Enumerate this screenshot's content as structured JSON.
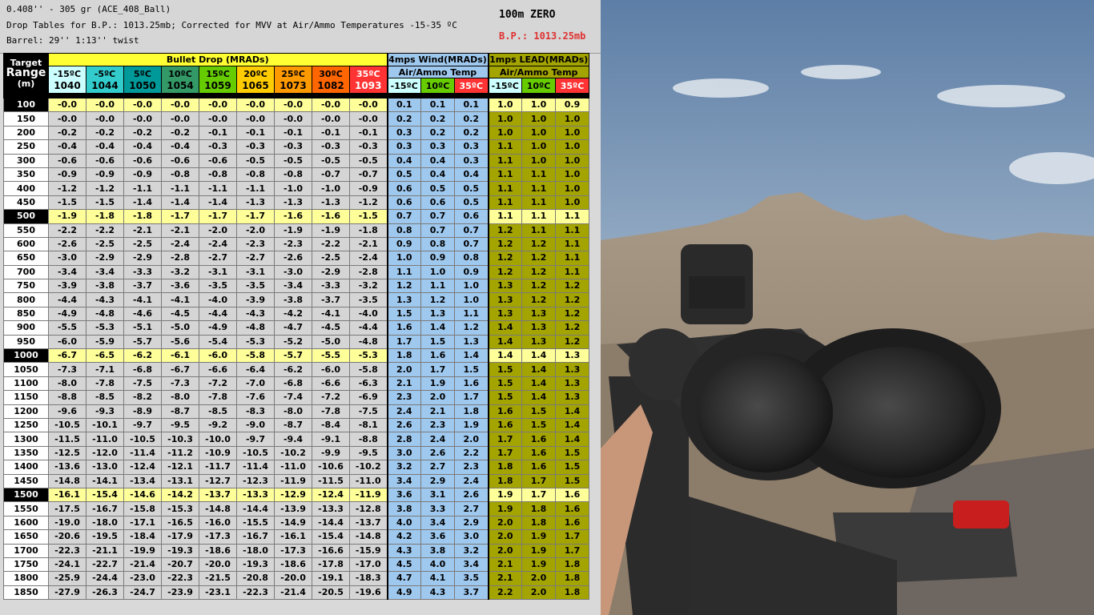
{
  "header": {
    "line1": "0.408'' - 305 gr (ACE_408_Ball)",
    "line2": "Drop Tables for B.P.: 1013.25mb; Corrected for MVV at Air/Ammo Temperatures -15-35 ºC",
    "line3": "Barrel: 29'' 1:13'' twist",
    "zero": "100m ZERO",
    "bp": "B.P.: 1013.25mb"
  },
  "table_header": {
    "target": "Target",
    "range": "Range",
    "unit": "(m)",
    "drop_title": "Bullet Drop (MRADs)",
    "wind_title": "4mps Wind(MRADs)",
    "lead_title": "1mps LEAD(MRADs)",
    "air_ammo": "Air/Ammo Temp",
    "drop_temps": [
      {
        "t": "-15ºC",
        "v": "1040"
      },
      {
        "t": "-5ºC",
        "v": "1044"
      },
      {
        "t": "5ºC",
        "v": "1050"
      },
      {
        "t": "10ºC",
        "v": "1054"
      },
      {
        "t": "15ºC",
        "v": "1059"
      },
      {
        "t": "20ºC",
        "v": "1065"
      },
      {
        "t": "25ºC",
        "v": "1073"
      },
      {
        "t": "30ºC",
        "v": "1082"
      },
      {
        "t": "35ºC",
        "v": "1093"
      }
    ],
    "wind_temps": [
      "-15ºC",
      "10ºC",
      "35ºC"
    ],
    "lead_temps": [
      "-15ºC",
      "10ºC",
      "35ºC"
    ]
  },
  "colors": {
    "drop_temp_colors": [
      "#ccffff",
      "#33cccc",
      "#009999",
      "#339966",
      "#66cc00",
      "#ffcc00",
      "#ff9900",
      "#ff6600",
      "#ff3333"
    ],
    "drop_value_colors": [
      "#000000",
      "#000000",
      "#000000",
      "#000000",
      "#000000",
      "#000000",
      "#000000",
      "#000000",
      "#ffffff"
    ],
    "wl_temp_colors": [
      "#ccffff",
      "#66cc00",
      "#ff3333"
    ],
    "wl_text_colors": [
      "#000000",
      "#000000",
      "#ffffff"
    ]
  },
  "rows": [
    {
      "range": "100",
      "hl": true,
      "drop": [
        "-0.0",
        "-0.0",
        "-0.0",
        "-0.0",
        "-0.0",
        "-0.0",
        "-0.0",
        "-0.0",
        "-0.0"
      ],
      "wind": [
        "0.1",
        "0.1",
        "0.1"
      ],
      "lead": [
        "1.0",
        "1.0",
        "0.9"
      ]
    },
    {
      "range": "150",
      "hl": false,
      "drop": [
        "-0.0",
        "-0.0",
        "-0.0",
        "-0.0",
        "-0.0",
        "-0.0",
        "-0.0",
        "-0.0",
        "-0.0"
      ],
      "wind": [
        "0.2",
        "0.2",
        "0.2"
      ],
      "lead": [
        "1.0",
        "1.0",
        "1.0"
      ]
    },
    {
      "range": "200",
      "hl": false,
      "drop": [
        "-0.2",
        "-0.2",
        "-0.2",
        "-0.2",
        "-0.1",
        "-0.1",
        "-0.1",
        "-0.1",
        "-0.1"
      ],
      "wind": [
        "0.3",
        "0.2",
        "0.2"
      ],
      "lead": [
        "1.0",
        "1.0",
        "1.0"
      ]
    },
    {
      "range": "250",
      "hl": false,
      "drop": [
        "-0.4",
        "-0.4",
        "-0.4",
        "-0.4",
        "-0.3",
        "-0.3",
        "-0.3",
        "-0.3",
        "-0.3"
      ],
      "wind": [
        "0.3",
        "0.3",
        "0.3"
      ],
      "lead": [
        "1.1",
        "1.0",
        "1.0"
      ]
    },
    {
      "range": "300",
      "hl": false,
      "drop": [
        "-0.6",
        "-0.6",
        "-0.6",
        "-0.6",
        "-0.6",
        "-0.5",
        "-0.5",
        "-0.5",
        "-0.5"
      ],
      "wind": [
        "0.4",
        "0.4",
        "0.3"
      ],
      "lead": [
        "1.1",
        "1.0",
        "1.0"
      ]
    },
    {
      "range": "350",
      "hl": false,
      "drop": [
        "-0.9",
        "-0.9",
        "-0.9",
        "-0.8",
        "-0.8",
        "-0.8",
        "-0.8",
        "-0.7",
        "-0.7"
      ],
      "wind": [
        "0.5",
        "0.4",
        "0.4"
      ],
      "lead": [
        "1.1",
        "1.1",
        "1.0"
      ]
    },
    {
      "range": "400",
      "hl": false,
      "drop": [
        "-1.2",
        "-1.2",
        "-1.1",
        "-1.1",
        "-1.1",
        "-1.1",
        "-1.0",
        "-1.0",
        "-0.9"
      ],
      "wind": [
        "0.6",
        "0.5",
        "0.5"
      ],
      "lead": [
        "1.1",
        "1.1",
        "1.0"
      ]
    },
    {
      "range": "450",
      "hl": false,
      "drop": [
        "-1.5",
        "-1.5",
        "-1.4",
        "-1.4",
        "-1.4",
        "-1.3",
        "-1.3",
        "-1.3",
        "-1.2"
      ],
      "wind": [
        "0.6",
        "0.6",
        "0.5"
      ],
      "lead": [
        "1.1",
        "1.1",
        "1.0"
      ]
    },
    {
      "range": "500",
      "hl": true,
      "drop": [
        "-1.9",
        "-1.8",
        "-1.8",
        "-1.7",
        "-1.7",
        "-1.7",
        "-1.6",
        "-1.6",
        "-1.5"
      ],
      "wind": [
        "0.7",
        "0.7",
        "0.6"
      ],
      "lead": [
        "1.1",
        "1.1",
        "1.1"
      ]
    },
    {
      "range": "550",
      "hl": false,
      "drop": [
        "-2.2",
        "-2.2",
        "-2.1",
        "-2.1",
        "-2.0",
        "-2.0",
        "-1.9",
        "-1.9",
        "-1.8"
      ],
      "wind": [
        "0.8",
        "0.7",
        "0.7"
      ],
      "lead": [
        "1.2",
        "1.1",
        "1.1"
      ]
    },
    {
      "range": "600",
      "hl": false,
      "drop": [
        "-2.6",
        "-2.5",
        "-2.5",
        "-2.4",
        "-2.4",
        "-2.3",
        "-2.3",
        "-2.2",
        "-2.1"
      ],
      "wind": [
        "0.9",
        "0.8",
        "0.7"
      ],
      "lead": [
        "1.2",
        "1.2",
        "1.1"
      ]
    },
    {
      "range": "650",
      "hl": false,
      "drop": [
        "-3.0",
        "-2.9",
        "-2.9",
        "-2.8",
        "-2.7",
        "-2.7",
        "-2.6",
        "-2.5",
        "-2.4"
      ],
      "wind": [
        "1.0",
        "0.9",
        "0.8"
      ],
      "lead": [
        "1.2",
        "1.2",
        "1.1"
      ]
    },
    {
      "range": "700",
      "hl": false,
      "drop": [
        "-3.4",
        "-3.4",
        "-3.3",
        "-3.2",
        "-3.1",
        "-3.1",
        "-3.0",
        "-2.9",
        "-2.8"
      ],
      "wind": [
        "1.1",
        "1.0",
        "0.9"
      ],
      "lead": [
        "1.2",
        "1.2",
        "1.1"
      ]
    },
    {
      "range": "750",
      "hl": false,
      "drop": [
        "-3.9",
        "-3.8",
        "-3.7",
        "-3.6",
        "-3.5",
        "-3.5",
        "-3.4",
        "-3.3",
        "-3.2"
      ],
      "wind": [
        "1.2",
        "1.1",
        "1.0"
      ],
      "lead": [
        "1.3",
        "1.2",
        "1.2"
      ]
    },
    {
      "range": "800",
      "hl": false,
      "drop": [
        "-4.4",
        "-4.3",
        "-4.1",
        "-4.1",
        "-4.0",
        "-3.9",
        "-3.8",
        "-3.7",
        "-3.5"
      ],
      "wind": [
        "1.3",
        "1.2",
        "1.0"
      ],
      "lead": [
        "1.3",
        "1.2",
        "1.2"
      ]
    },
    {
      "range": "850",
      "hl": false,
      "drop": [
        "-4.9",
        "-4.8",
        "-4.6",
        "-4.5",
        "-4.4",
        "-4.3",
        "-4.2",
        "-4.1",
        "-4.0"
      ],
      "wind": [
        "1.5",
        "1.3",
        "1.1"
      ],
      "lead": [
        "1.3",
        "1.3",
        "1.2"
      ]
    },
    {
      "range": "900",
      "hl": false,
      "drop": [
        "-5.5",
        "-5.3",
        "-5.1",
        "-5.0",
        "-4.9",
        "-4.8",
        "-4.7",
        "-4.5",
        "-4.4"
      ],
      "wind": [
        "1.6",
        "1.4",
        "1.2"
      ],
      "lead": [
        "1.4",
        "1.3",
        "1.2"
      ]
    },
    {
      "range": "950",
      "hl": false,
      "drop": [
        "-6.0",
        "-5.9",
        "-5.7",
        "-5.6",
        "-5.4",
        "-5.3",
        "-5.2",
        "-5.0",
        "-4.8"
      ],
      "wind": [
        "1.7",
        "1.5",
        "1.3"
      ],
      "lead": [
        "1.4",
        "1.3",
        "1.2"
      ]
    },
    {
      "range": "1000",
      "hl": true,
      "drop": [
        "-6.7",
        "-6.5",
        "-6.2",
        "-6.1",
        "-6.0",
        "-5.8",
        "-5.7",
        "-5.5",
        "-5.3"
      ],
      "wind": [
        "1.8",
        "1.6",
        "1.4"
      ],
      "lead": [
        "1.4",
        "1.4",
        "1.3"
      ]
    },
    {
      "range": "1050",
      "hl": false,
      "drop": [
        "-7.3",
        "-7.1",
        "-6.8",
        "-6.7",
        "-6.6",
        "-6.4",
        "-6.2",
        "-6.0",
        "-5.8"
      ],
      "wind": [
        "2.0",
        "1.7",
        "1.5"
      ],
      "lead": [
        "1.5",
        "1.4",
        "1.3"
      ]
    },
    {
      "range": "1100",
      "hl": false,
      "drop": [
        "-8.0",
        "-7.8",
        "-7.5",
        "-7.3",
        "-7.2",
        "-7.0",
        "-6.8",
        "-6.6",
        "-6.3"
      ],
      "wind": [
        "2.1",
        "1.9",
        "1.6"
      ],
      "lead": [
        "1.5",
        "1.4",
        "1.3"
      ]
    },
    {
      "range": "1150",
      "hl": false,
      "drop": [
        "-8.8",
        "-8.5",
        "-8.2",
        "-8.0",
        "-7.8",
        "-7.6",
        "-7.4",
        "-7.2",
        "-6.9"
      ],
      "wind": [
        "2.3",
        "2.0",
        "1.7"
      ],
      "lead": [
        "1.5",
        "1.4",
        "1.3"
      ]
    },
    {
      "range": "1200",
      "hl": false,
      "drop": [
        "-9.6",
        "-9.3",
        "-8.9",
        "-8.7",
        "-8.5",
        "-8.3",
        "-8.0",
        "-7.8",
        "-7.5"
      ],
      "wind": [
        "2.4",
        "2.1",
        "1.8"
      ],
      "lead": [
        "1.6",
        "1.5",
        "1.4"
      ]
    },
    {
      "range": "1250",
      "hl": false,
      "drop": [
        "-10.5",
        "-10.1",
        "-9.7",
        "-9.5",
        "-9.2",
        "-9.0",
        "-8.7",
        "-8.4",
        "-8.1"
      ],
      "wind": [
        "2.6",
        "2.3",
        "1.9"
      ],
      "lead": [
        "1.6",
        "1.5",
        "1.4"
      ]
    },
    {
      "range": "1300",
      "hl": false,
      "drop": [
        "-11.5",
        "-11.0",
        "-10.5",
        "-10.3",
        "-10.0",
        "-9.7",
        "-9.4",
        "-9.1",
        "-8.8"
      ],
      "wind": [
        "2.8",
        "2.4",
        "2.0"
      ],
      "lead": [
        "1.7",
        "1.6",
        "1.4"
      ]
    },
    {
      "range": "1350",
      "hl": false,
      "drop": [
        "-12.5",
        "-12.0",
        "-11.4",
        "-11.2",
        "-10.9",
        "-10.5",
        "-10.2",
        "-9.9",
        "-9.5"
      ],
      "wind": [
        "3.0",
        "2.6",
        "2.2"
      ],
      "lead": [
        "1.7",
        "1.6",
        "1.5"
      ]
    },
    {
      "range": "1400",
      "hl": false,
      "drop": [
        "-13.6",
        "-13.0",
        "-12.4",
        "-12.1",
        "-11.7",
        "-11.4",
        "-11.0",
        "-10.6",
        "-10.2"
      ],
      "wind": [
        "3.2",
        "2.7",
        "2.3"
      ],
      "lead": [
        "1.8",
        "1.6",
        "1.5"
      ]
    },
    {
      "range": "1450",
      "hl": false,
      "drop": [
        "-14.8",
        "-14.1",
        "-13.4",
        "-13.1",
        "-12.7",
        "-12.3",
        "-11.9",
        "-11.5",
        "-11.0"
      ],
      "wind": [
        "3.4",
        "2.9",
        "2.4"
      ],
      "lead": [
        "1.8",
        "1.7",
        "1.5"
      ]
    },
    {
      "range": "1500",
      "hl": true,
      "drop": [
        "-16.1",
        "-15.4",
        "-14.6",
        "-14.2",
        "-13.7",
        "-13.3",
        "-12.9",
        "-12.4",
        "-11.9"
      ],
      "wind": [
        "3.6",
        "3.1",
        "2.6"
      ],
      "lead": [
        "1.9",
        "1.7",
        "1.6"
      ]
    },
    {
      "range": "1550",
      "hl": false,
      "drop": [
        "-17.5",
        "-16.7",
        "-15.8",
        "-15.3",
        "-14.8",
        "-14.4",
        "-13.9",
        "-13.3",
        "-12.8"
      ],
      "wind": [
        "3.8",
        "3.3",
        "2.7"
      ],
      "lead": [
        "1.9",
        "1.8",
        "1.6"
      ]
    },
    {
      "range": "1600",
      "hl": false,
      "drop": [
        "-19.0",
        "-18.0",
        "-17.1",
        "-16.5",
        "-16.0",
        "-15.5",
        "-14.9",
        "-14.4",
        "-13.7"
      ],
      "wind": [
        "4.0",
        "3.4",
        "2.9"
      ],
      "lead": [
        "2.0",
        "1.8",
        "1.6"
      ]
    },
    {
      "range": "1650",
      "hl": false,
      "drop": [
        "-20.6",
        "-19.5",
        "-18.4",
        "-17.9",
        "-17.3",
        "-16.7",
        "-16.1",
        "-15.4",
        "-14.8"
      ],
      "wind": [
        "4.2",
        "3.6",
        "3.0"
      ],
      "lead": [
        "2.0",
        "1.9",
        "1.7"
      ]
    },
    {
      "range": "1700",
      "hl": false,
      "drop": [
        "-22.3",
        "-21.1",
        "-19.9",
        "-19.3",
        "-18.6",
        "-18.0",
        "-17.3",
        "-16.6",
        "-15.9"
      ],
      "wind": [
        "4.3",
        "3.8",
        "3.2"
      ],
      "lead": [
        "2.0",
        "1.9",
        "1.7"
      ]
    },
    {
      "range": "1750",
      "hl": false,
      "drop": [
        "-24.1",
        "-22.7",
        "-21.4",
        "-20.7",
        "-20.0",
        "-19.3",
        "-18.6",
        "-17.8",
        "-17.0"
      ],
      "wind": [
        "4.5",
        "4.0",
        "3.4"
      ],
      "lead": [
        "2.1",
        "1.9",
        "1.8"
      ]
    },
    {
      "range": "1800",
      "hl": false,
      "drop": [
        "-25.9",
        "-24.4",
        "-23.0",
        "-22.3",
        "-21.5",
        "-20.8",
        "-20.0",
        "-19.1",
        "-18.3"
      ],
      "wind": [
        "4.7",
        "4.1",
        "3.5"
      ],
      "lead": [
        "2.1",
        "2.0",
        "1.8"
      ]
    },
    {
      "range": "1850",
      "hl": false,
      "drop": [
        "-27.9",
        "-26.3",
        "-24.7",
        "-23.9",
        "-23.1",
        "-22.3",
        "-21.4",
        "-20.5",
        "-19.6"
      ],
      "wind": [
        "4.9",
        "4.3",
        "3.7"
      ],
      "lead": [
        "2.2",
        "2.0",
        "1.8"
      ]
    }
  ]
}
